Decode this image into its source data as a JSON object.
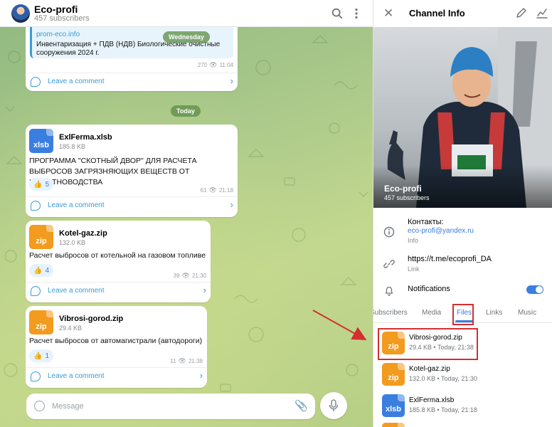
{
  "chat": {
    "title": "Eco-profi",
    "subscribers": "457 subscribers",
    "messages_top": {
      "link": "prom-eco.info",
      "text": "Инвентаризация + ПДВ (НДВ) Биологические очистные сооружения 2024 г.",
      "views": "270",
      "time": "11:04",
      "comment_label": "Leave a comment"
    },
    "date_wednesday": "Wednesday",
    "date_today": "Today",
    "messages": [
      {
        "file_name": "ExlFerma.xlsb",
        "file_size": "185.8 KB",
        "file_ext": "xlsb",
        "text": "ПРОГРАММА \"СКОТНЫЙ ДВОР\" ДЛЯ РАСЧЕТА ВЫБРОСОВ ЗАГРЯЗНЯЮЩИХ ВЕЩЕСТВ ОТ ЖИВОТНОВОДСТВА",
        "reaction_emoji": "👍",
        "reaction_count": "5",
        "views": "61",
        "time": "21:18",
        "comment_label": "Leave a comment"
      },
      {
        "file_name": "Kotel-gaz.zip",
        "file_size": "132.0 KB",
        "file_ext": "zip",
        "text": "Расчет выбросов от котельной на газовом топливе",
        "reaction_emoji": "👍",
        "reaction_count": "4",
        "views": "39",
        "time": "21:30",
        "comment_label": "Leave a comment"
      },
      {
        "file_name": "Vibrosi-gorod.zip",
        "file_size": "29.4 KB",
        "file_ext": "zip",
        "text": "Расчет выбросов от автомагистрали (автодороги)",
        "reaction_emoji": "👍",
        "reaction_count": "1",
        "views": "11",
        "time": "21:38",
        "comment_label": "Leave a comment"
      }
    ],
    "input": {
      "placeholder": "Message",
      "value": ""
    }
  },
  "info": {
    "title": "Channel Info",
    "channel_name": "Eco-profi",
    "channel_subscribers": "457 subscribers",
    "contacts_label": "Контакты:",
    "contacts_email": "eco-profi@yandex.ru",
    "contacts_sub": "Info",
    "link_url": "https://t.me/ecoprofi_DA",
    "link_sub": "Link",
    "notifications_label": "Notifications",
    "notifications_on": true,
    "tabs": [
      "Subscribers",
      "Media",
      "Files",
      "Links",
      "Music"
    ],
    "active_tab": "Files",
    "files": [
      {
        "name": "Vibrosi-gorod.zip",
        "meta": "29.4 KB • Today, 21:38",
        "ext": "zip"
      },
      {
        "name": "Kotel-gaz.zip",
        "meta": "132.0 KB • Today, 21:30",
        "ext": "zip"
      },
      {
        "name": "ExlFerma.xlsb",
        "meta": "185.8 KB • Today, 21:18",
        "ext": "xlsb"
      }
    ]
  },
  "colors": {
    "accent": "#3a7ee0",
    "zip_icon": "#f29b1e",
    "xlsb_icon": "#3a7ee0",
    "annotation": "#d32f2f"
  }
}
